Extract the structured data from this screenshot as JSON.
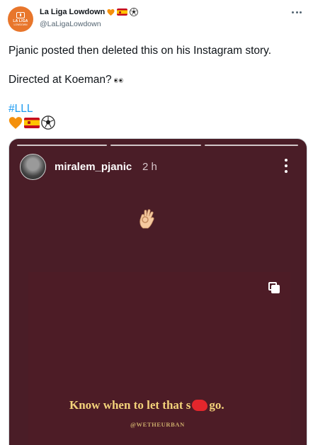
{
  "account": {
    "display_name": "La Liga Lowdown",
    "handle": "@LaLigaLowdown",
    "avatar_text_1": "LA LIGA",
    "avatar_text_2": "LOWDOWN",
    "name_emojis": [
      "orange-heart-icon",
      "spain-flag-icon",
      "soccer-ball-icon"
    ]
  },
  "tweet": {
    "line1": "Pjanic posted then deleted this on his Instagram story.",
    "line2": "Directed at Koeman?",
    "hashtag": "#LLL",
    "emojis": [
      "orange-heart-icon",
      "spain-flag-icon",
      "soccer-ball-icon"
    ]
  },
  "story": {
    "username": "miralem_pjanic",
    "time": "2 h",
    "progress_segments": 3,
    "quote_before": "Know when to let that s",
    "quote_after": "go.",
    "credit": "@WETHEURBAN"
  },
  "colors": {
    "accent": "#1d9bf0",
    "story_bg": "#4a1d27",
    "quote": "#f3d27a",
    "redaction": "#e3262c",
    "avatar": "#e8762b"
  }
}
